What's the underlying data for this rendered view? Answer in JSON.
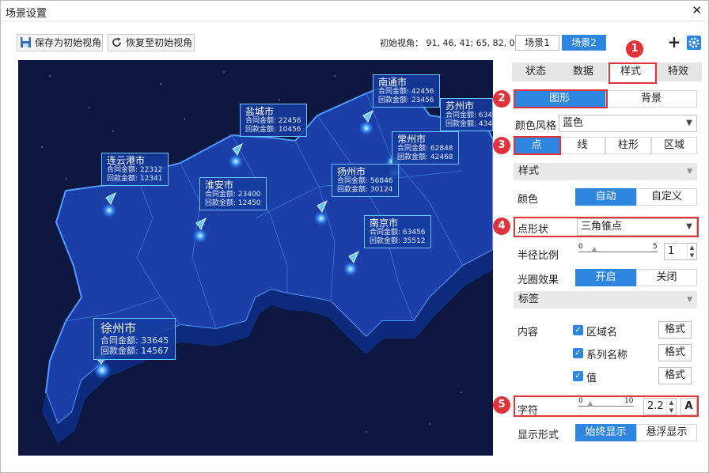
{
  "window": {
    "title": "场景设置"
  },
  "toolbar": {
    "save_label": "保存为初始视角",
    "restore_label": "恢复至初始视角",
    "initial_view": "初始视角： 91, 46, 41; 65, 82, 0",
    "scene1": "场景1",
    "scene2": "场景2"
  },
  "map": {
    "labels": [
      {
        "city": "南通市",
        "l1": "合同金额: 42456",
        "l2": "回款金额: 23456"
      },
      {
        "city": "苏州市",
        "l1": "合同金额: 634",
        "l2": "回款金额: 434"
      },
      {
        "city": "盐城市",
        "l1": "合同金额: 22456",
        "l2": "回款金额: 10456"
      },
      {
        "city": "常州市",
        "l1": "合同金额: 62848",
        "l2": "回款金额: 42468"
      },
      {
        "city": "连云港市",
        "l1": "合同金额: 22312",
        "l2": "回款金额: 12341"
      },
      {
        "city": "扬州市",
        "l1": "合同金额: 56846",
        "l2": "回款金额: 30124"
      },
      {
        "city": "淮安市",
        "l1": "合同金额: 23400",
        "l2": "回款金额: 12450"
      },
      {
        "city": "南京市",
        "l1": "合同金额: 63456",
        "l2": "回款金额: 35512"
      },
      {
        "city": "徐州市",
        "l1": "合同金额: 33645",
        "l2": "回款金额: 14567"
      }
    ]
  },
  "panel": {
    "tabs": [
      "状态",
      "数据",
      "样式",
      "特效"
    ],
    "subtabs": [
      "图形",
      "背景"
    ],
    "color_style_label": "颜色风格",
    "color_style_value": "蓝色",
    "shape_tabs": [
      "点",
      "线",
      "柱形",
      "区域"
    ],
    "section_style": "样式",
    "color_label": "颜色",
    "color_opts": [
      "自动",
      "自定义"
    ],
    "point_shape_label": "点形状",
    "point_shape_value": "三角锥点",
    "radius_label": "半径比例",
    "radius_min": "0",
    "radius_max": "5",
    "radius_value": "1",
    "halo_label": "光圈效果",
    "halo_opts": [
      "开启",
      "关闭"
    ],
    "section_label": "标签",
    "content_label": "内容",
    "content_items": [
      "区域名",
      "系列名称",
      "值"
    ],
    "format_label": "格式",
    "char_label": "字符",
    "char_min": "0",
    "char_max": "10",
    "char_value": "2.2",
    "font_btn": "A",
    "display_label": "显示形式",
    "display_opts": [
      "始终显示",
      "悬浮显示"
    ]
  },
  "callouts": [
    "1",
    "2",
    "3",
    "4",
    "5"
  ],
  "colors": {
    "accent": "#2e86e0",
    "callout": "#e0333a",
    "map_bg": "#0d1740"
  }
}
